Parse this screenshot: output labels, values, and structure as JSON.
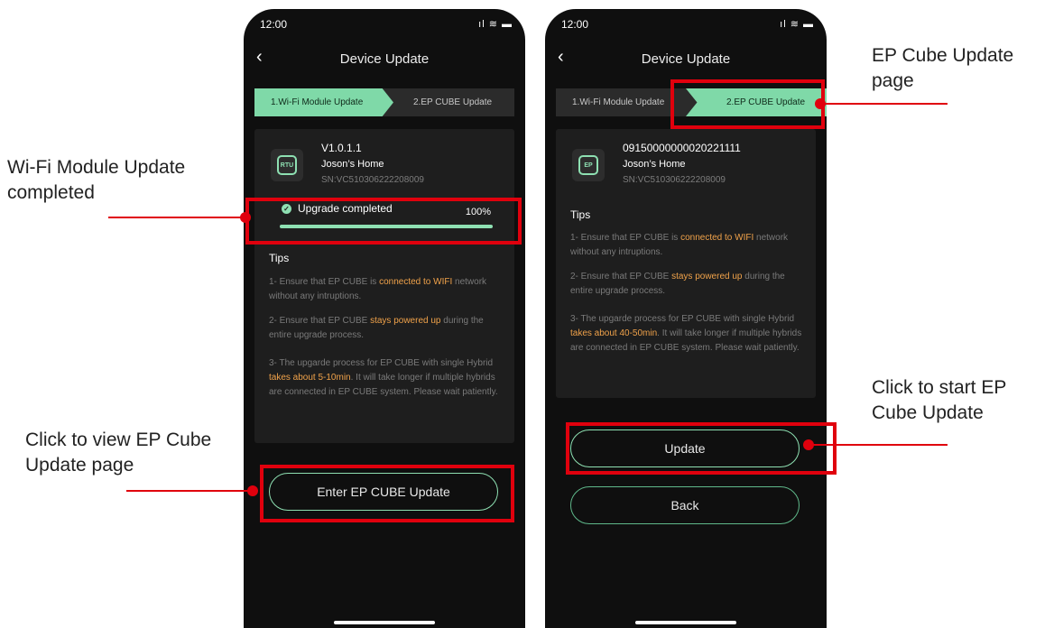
{
  "phone1": {
    "time": "12:00",
    "status_icons": "ıl ≋ ▬",
    "title": "Device Update",
    "step1": "1.Wi-Fi Module Update",
    "step2": "2.EP CUBE Update",
    "device": {
      "icon": "RTU",
      "version": "V1.0.1.1",
      "name": "Joson’s Home",
      "sn": "SN:VC510306222208009"
    },
    "progress": {
      "text": "Upgrade completed",
      "percent": "100%",
      "value": 1.0
    },
    "tips_title": "Tips",
    "tip1_pre": "1- Ensure that EP CUBE is ",
    "tip1_hl": "connected to WIFI",
    "tip1_post": " network without any intruptions.",
    "tip2_pre": "2- Ensure that EP CUBE ",
    "tip2_hl": "stays powered up",
    "tip2_post": " during the entire upgrade process.",
    "tip3_pre": "3- The upgarde process for EP CUBE with single Hybrid ",
    "tip3_hl": "takes about 5-10min",
    "tip3_post": ". It will take longer if multiple hybrids are connected in EP CUBE system. Please wait patiently.",
    "button": "Enter EP CUBE Update"
  },
  "phone2": {
    "time": "12:00",
    "status_icons": "ıl ≋ ▬",
    "title": "Device Update",
    "step1": "1.Wi-Fi Module Update",
    "step2": "2.EP CUBE Update",
    "device": {
      "icon": "EP",
      "version": "09150000000020221111",
      "name": "Joson’s Home",
      "sn": "SN:VC510306222208009"
    },
    "tips_title": "Tips",
    "tip1_pre": "1- Ensure that EP CUBE is ",
    "tip1_hl": "connected to WIFI",
    "tip1_post": " network without any intruptions.",
    "tip2_pre": "2- Ensure that EP CUBE ",
    "tip2_hl": "stays powered up",
    "tip2_post": " during the entire upgrade process.",
    "tip3_pre": "3- The upgarde process for EP CUBE with single Hybrid ",
    "tip3_hl": "takes about 40-50min",
    "tip3_post": ". It will take longer if multiple hybrids are connected in EP CUBE system. Please wait patiently.",
    "update_button": "Update",
    "back_button": "Back"
  },
  "annotations": {
    "wifi_done": "Wi-Fi Module Update completed",
    "view_ep": "Click to view EP Cube Update page",
    "ep_page": "EP Cube Update page",
    "start_ep": "Click to start EP Cube Update"
  },
  "colors": {
    "accent": "#8ee0b2",
    "highlight": "#f0a24a",
    "annotation": "#e0000d"
  }
}
